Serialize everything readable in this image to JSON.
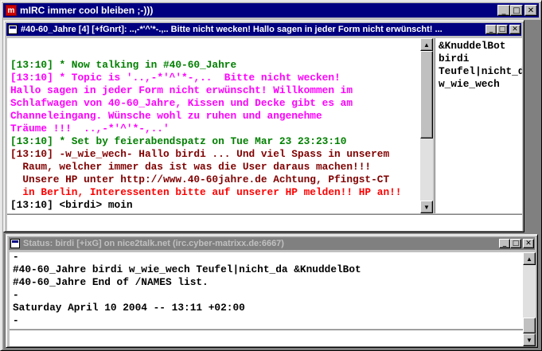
{
  "app": {
    "title": "mIRC immer cool bleiben  ;-)))",
    "icon_label": "m"
  },
  "channel_window": {
    "title": "#40-60_Jahre [4] [+fGnrt]: ..,-*'^'*-.,.. Bitte nicht wecken! Hallo sagen in jeder Form nicht erwünscht! ...",
    "colors": {
      "green": "#008000",
      "magenta": "#ff00ff",
      "red": "#ff0000",
      "darkred": "#800000",
      "black": "#000000",
      "blue": "#0000ff"
    },
    "messages": [
      {
        "time": "[13:10]",
        "text": " * Now talking in #40-60_Jahre",
        "color": "#008000"
      },
      {
        "time": "[13:10]",
        "text": " * Topic is '..,-*'^'*-,..  Bitte nicht wecken!",
        "color": "#ff00ff"
      },
      {
        "time": "",
        "text": "Hallo sagen in jeder Form nicht erwünscht! Willkommen im",
        "color": "#ff00ff"
      },
      {
        "time": "",
        "text": "Schlafwagen von 40-60_Jahre, Kissen und Decke gibt es am",
        "color": "#ff00ff"
      },
      {
        "time": "",
        "text": "Channeleingang. Wünsche wohl zu ruhen und angenehme",
        "color": "#ff00ff"
      },
      {
        "time": "",
        "text": "Träume !!!  ..,-*'^'*-,..'",
        "color": "#ff00ff"
      },
      {
        "time": "[13:10]",
        "text": " * Set by feierabendspatz on Tue Mar 23 23:23:10",
        "color": "#008000"
      },
      {
        "time": "[13:10]",
        "text": " -w_wie_wech- Hallo birdi ... Und viel Spass in unserem",
        "color": "#800000"
      },
      {
        "time": "",
        "text": "  Raum, welcher immer das ist was die User daraus machen!!!",
        "color": "#800000"
      },
      {
        "time": "",
        "text": "  Unsere HP unter http://www.40-60jahre.de Achtung, Pfingst-CT",
        "color": "#800000"
      },
      {
        "time": "",
        "text": "  in Berlin, Interessenten bitte auf unserer HP melden!! HP an!!",
        "color": "#ff0000"
      },
      {
        "time": "[13:10]",
        "text": " <birdi> moin",
        "color": "#000000"
      }
    ],
    "nicklist": [
      "&KnuddelBot",
      "birdi",
      "Teufel|nicht_da",
      "w_wie_wech"
    ],
    "input_value": ""
  },
  "status_window": {
    "title": "Status: birdi [+ixG] on nice2talk.net (irc.cyber-matrixx.de:6667)",
    "lines": [
      "-",
      "#40-60_Jahre birdi w_wie_wech Teufel|nicht_da &KnuddelBot",
      "#40-60_Jahre End of /NAMES list.",
      "-",
      "Saturday April 10 2004 -- 13:11 +02:00",
      "-"
    ],
    "input_value": ""
  },
  "buttons": {
    "minimize": "_",
    "maximize": "□",
    "close": "✕"
  }
}
